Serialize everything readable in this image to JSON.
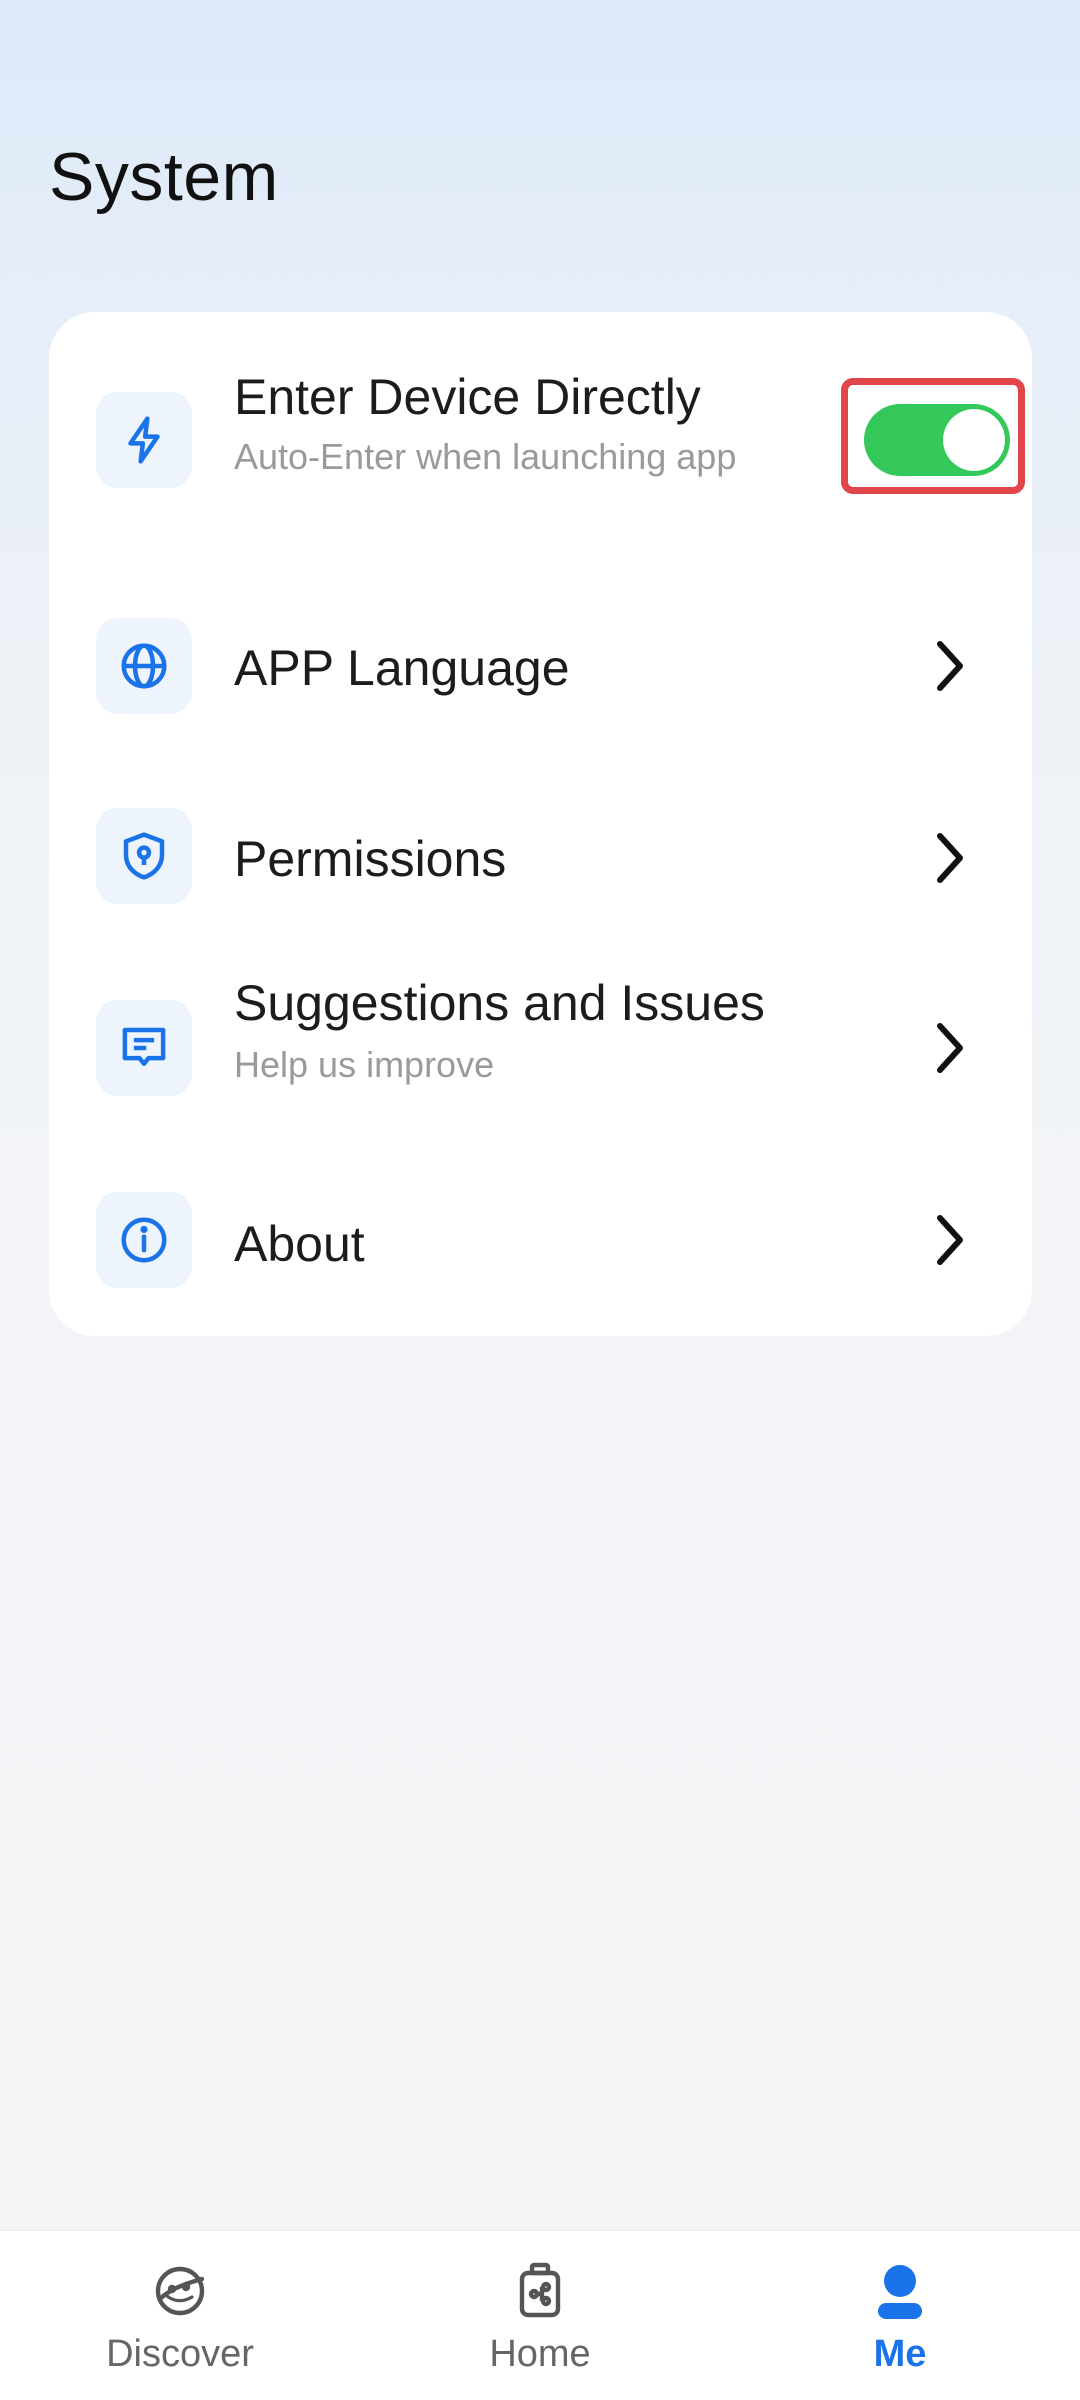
{
  "page": {
    "title": "System"
  },
  "settings": [
    {
      "title": "Enter Device Directly",
      "subtitle": "Auto-Enter when launching app",
      "icon": "lightning-icon",
      "control": "toggle",
      "toggle_on": true
    },
    {
      "title": "APP Language",
      "icon": "globe-icon",
      "control": "chevron"
    },
    {
      "title": "Permissions",
      "icon": "shield-lock-icon",
      "control": "chevron"
    },
    {
      "title": "Suggestions and Issues",
      "subtitle": "Help us improve",
      "icon": "feedback-message-icon",
      "control": "chevron"
    },
    {
      "title": "About",
      "icon": "info-icon",
      "control": "chevron"
    }
  ],
  "bottom_nav": [
    {
      "label": "Discover",
      "icon": "planet-face-icon",
      "active": false
    },
    {
      "label": "Home",
      "icon": "device-hub-icon",
      "active": false
    },
    {
      "label": "Me",
      "icon": "person-icon",
      "active": true
    }
  ],
  "colors": {
    "accent": "#1a73e8",
    "toggle_on": "#34c759",
    "highlight": "#e2454a"
  }
}
